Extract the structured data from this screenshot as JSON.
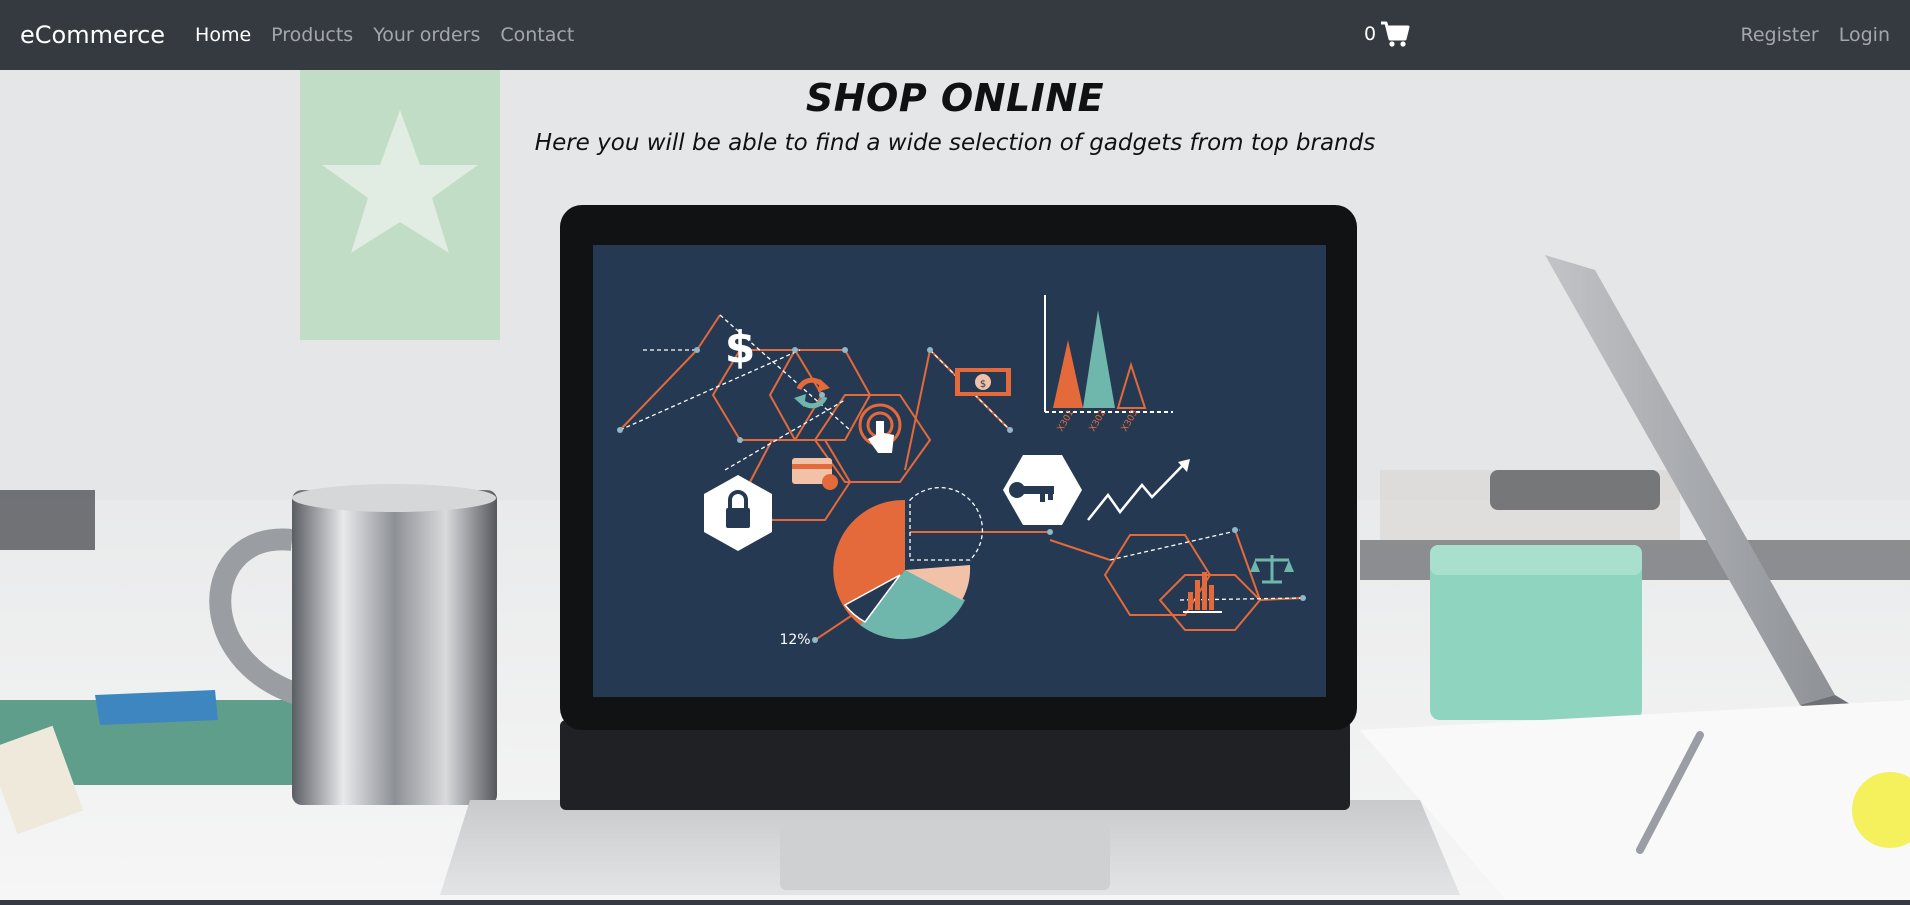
{
  "navbar": {
    "brand": "eCommerce",
    "links": [
      {
        "label": "Home",
        "active": true
      },
      {
        "label": "Products",
        "active": false
      },
      {
        "label": "Your orders",
        "active": false
      },
      {
        "label": "Contact",
        "active": false
      }
    ],
    "cart": {
      "count": "0",
      "icon": "shopping-cart-icon"
    },
    "right_links": [
      {
        "label": "Register"
      },
      {
        "label": "Login"
      }
    ]
  },
  "hero": {
    "title": "SHOP ONLINE",
    "subtitle": "Here you will be able to find a wide selection of gadgets from top brands",
    "screen_labels": {
      "percent": "12%",
      "axis_labels": [
        "X301",
        "X302",
        "X303"
      ]
    }
  },
  "colors": {
    "navbar": "#343a40",
    "screen": "#253a52",
    "accent_orange": "#e4693b",
    "accent_teal": "#6fb7ac",
    "accent_peach": "#f2c2a8"
  }
}
